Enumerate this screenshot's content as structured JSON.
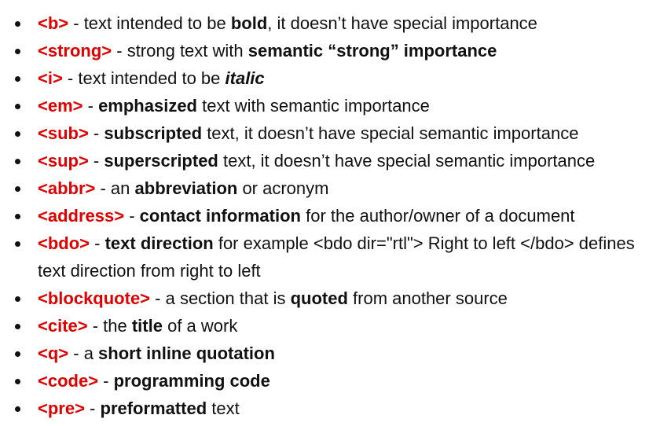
{
  "items": [
    {
      "tag": "<b>",
      "parts": [
        " - text intended to be ",
        "bold",
        ", it doesn’t have special importance"
      ]
    },
    {
      "tag": "<strong>",
      "parts": [
        " - strong text with ",
        "semantic “strong” importance"
      ]
    },
    {
      "tag": "<i>",
      "parts": [
        " - text intended to be ",
        "italic"
      ]
    },
    {
      "tag": "<em>",
      "parts": [
        " - ",
        "emphasized",
        " text with semantic importance"
      ]
    },
    {
      "tag": "<sub>",
      "parts": [
        " - ",
        "subscripted",
        " text, it doesn’t have special semantic importance"
      ]
    },
    {
      "tag": "<sup>",
      "parts": [
        " - ",
        "superscripted",
        " text, it doesn’t have special semantic importance"
      ]
    },
    {
      "tag": "<abbr>",
      "parts": [
        " - an ",
        "abbreviation",
        " or acronym"
      ]
    },
    {
      "tag": "<address>",
      "parts": [
        " - ",
        "contact information",
        " for the author/owner of a document"
      ]
    },
    {
      "tag": "<bdo>",
      "parts": [
        " - ",
        "text direction",
        " for example <bdo dir=\"rtl\"> Right to left </bdo> defines text direction from right to left"
      ]
    },
    {
      "tag": "<blockquote>",
      "parts": [
        " - a section that is ",
        "quoted",
        " from another source"
      ]
    },
    {
      "tag": "<cite>",
      "parts": [
        " - the ",
        "title",
        " of a work"
      ]
    },
    {
      "tag": "<q>",
      "parts": [
        " - a ",
        "short inline quotation"
      ]
    },
    {
      "tag": "<code>",
      "parts": [
        " - ",
        "programming code"
      ]
    },
    {
      "tag": "<pre>",
      "parts": [
        " - ",
        "preformatted",
        " text"
      ]
    }
  ]
}
